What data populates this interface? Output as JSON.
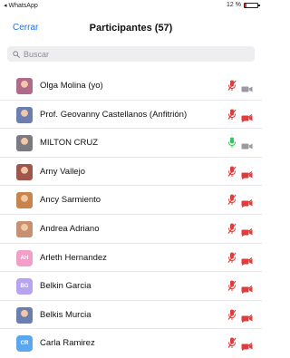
{
  "statusbar": {
    "carrier": "◂ WhatsApp",
    "battery_text": "12 %",
    "battery_level": 0.12
  },
  "nav": {
    "cancel_label": "Cerrar",
    "title": "Participantes (57)"
  },
  "search": {
    "placeholder": "Buscar"
  },
  "colors": {
    "accent": "#1a73e8",
    "muted_red": "#e23b3b",
    "unmuted_green": "#34c759",
    "cam_off_gray": "#9a9aa0"
  },
  "participants": [
    {
      "name": "Olga Molina (yo)",
      "avatar": "photo",
      "mic": "muted",
      "cam": "gray"
    },
    {
      "name": "Prof. Geovanny Castellanos (Anfitrión)",
      "avatar": "photo",
      "mic": "muted",
      "cam": "off"
    },
    {
      "name": "MILTON CRUZ",
      "avatar": "photo",
      "mic": "on",
      "cam": "gray"
    },
    {
      "name": "Arny Vallejo",
      "avatar": "photo",
      "mic": "muted",
      "cam": "off"
    },
    {
      "name": "Ancy Sarmiento",
      "avatar": "photo",
      "mic": "muted",
      "cam": "off"
    },
    {
      "name": "Andrea Adriano",
      "avatar": "photo",
      "mic": "muted",
      "cam": "off"
    },
    {
      "name": "Arleth Hernandez",
      "avatar": "initials",
      "initials": "AH",
      "avatar_color": "#f3a0c8",
      "mic": "muted",
      "cam": "off"
    },
    {
      "name": "Belkin Garcia",
      "avatar": "initials",
      "initials": "BG",
      "avatar_color": "#b7a3f0",
      "mic": "muted",
      "cam": "off"
    },
    {
      "name": "Belkis Murcia",
      "avatar": "photo",
      "mic": "muted",
      "cam": "off"
    },
    {
      "name": "Carla Ramirez",
      "avatar": "initials",
      "initials": "CR",
      "avatar_color": "#5aa7f0",
      "mic": "muted",
      "cam": "off"
    }
  ]
}
